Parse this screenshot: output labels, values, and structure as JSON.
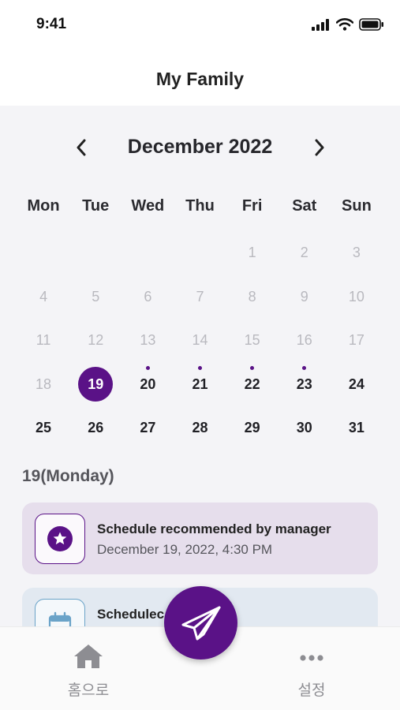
{
  "status_bar": {
    "time": "9:41"
  },
  "header": {
    "title": "My Family"
  },
  "calendar": {
    "month_label": "December 2022",
    "weekdays": [
      "Mon",
      "Tue",
      "Wed",
      "Thu",
      "Fri",
      "Sat",
      "Sun"
    ],
    "days": [
      {
        "label": "",
        "state": "empty"
      },
      {
        "label": "",
        "state": "empty"
      },
      {
        "label": "",
        "state": "empty"
      },
      {
        "label": "",
        "state": "empty"
      },
      {
        "label": "1",
        "state": "muted"
      },
      {
        "label": "2",
        "state": "muted"
      },
      {
        "label": "3",
        "state": "muted"
      },
      {
        "label": "4",
        "state": "muted"
      },
      {
        "label": "5",
        "state": "muted"
      },
      {
        "label": "6",
        "state": "muted"
      },
      {
        "label": "7",
        "state": "muted"
      },
      {
        "label": "8",
        "state": "muted"
      },
      {
        "label": "9",
        "state": "muted"
      },
      {
        "label": "10",
        "state": "muted"
      },
      {
        "label": "11",
        "state": "muted"
      },
      {
        "label": "12",
        "state": "muted"
      },
      {
        "label": "13",
        "state": "muted"
      },
      {
        "label": "14",
        "state": "muted"
      },
      {
        "label": "15",
        "state": "muted"
      },
      {
        "label": "16",
        "state": "muted"
      },
      {
        "label": "17",
        "state": "muted"
      },
      {
        "label": "18",
        "state": "muted"
      },
      {
        "label": "19",
        "state": "selected"
      },
      {
        "label": "20",
        "state": "event"
      },
      {
        "label": "21",
        "state": "event"
      },
      {
        "label": "22",
        "state": "event"
      },
      {
        "label": "23",
        "state": "event"
      },
      {
        "label": "24",
        "state": "normal"
      },
      {
        "label": "25",
        "state": "normal"
      },
      {
        "label": "26",
        "state": "normal"
      },
      {
        "label": "27",
        "state": "normal"
      },
      {
        "label": "28",
        "state": "normal"
      },
      {
        "label": "29",
        "state": "normal"
      },
      {
        "label": "30",
        "state": "normal"
      },
      {
        "label": "31",
        "state": "normal"
      }
    ]
  },
  "selected_date_label": "19(Monday)",
  "events": [
    {
      "title": "Schedule recommended by manager",
      "time": "December 19, 2022, 4:30 PM",
      "icon": "star-icon"
    },
    {
      "title": "Schedulec",
      "time": "",
      "icon": "calendar-icon"
    }
  ],
  "bottom_nav": {
    "home_label": "홈으로",
    "settings_label": "설정"
  },
  "colors": {
    "accent": "#5a1287",
    "card_primary_bg": "#e6deec",
    "card_secondary_bg": "#e2e9f1"
  }
}
